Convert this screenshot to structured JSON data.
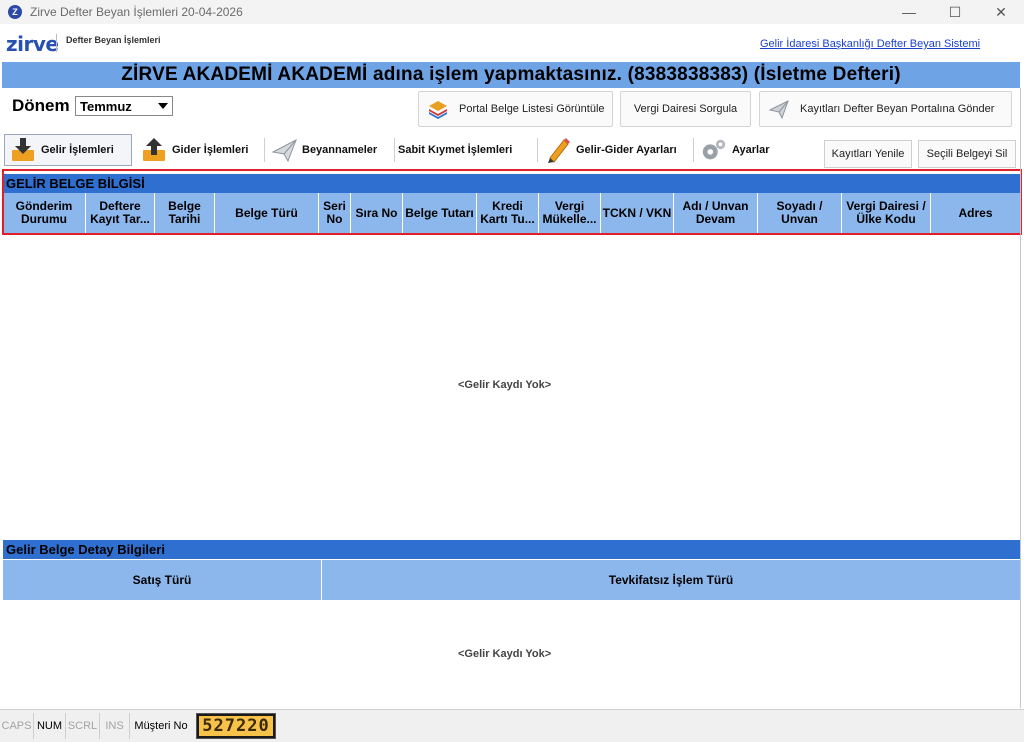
{
  "window": {
    "title": "Zirve Defter Beyan İşlemleri 20-04-2026",
    "icon_letter": "Z",
    "minimize": "—",
    "maximize": "☐",
    "close": "✕"
  },
  "header": {
    "logo": "zirve",
    "module_name": "Defter Beyan İşlemleri",
    "portal_link": "Gelir İdaresi Başkanlığı Defter Beyan Sistemi"
  },
  "banner": {
    "text": "ZİRVE AKADEMİ AKADEMİ adına işlem yapmaktasınız. (8383838383) (İsletme Defteri)"
  },
  "period": {
    "label": "Dönem",
    "selected": "Temmuz"
  },
  "toolbar": {
    "portal_list": "Portal Belge Listesi Görüntüle",
    "tax_office_query": "Vergi Dairesi Sorgula",
    "send_records": "Kayıtları Defter Beyan Portalına Gönder"
  },
  "tabs": [
    {
      "label": "Gelir İşlemleri"
    },
    {
      "label": "Gider İşlemleri"
    },
    {
      "label": "Beyannameler"
    },
    {
      "label": "Sabit Kıymet İşlemleri"
    },
    {
      "label": "Gelir-Gider Ayarları"
    },
    {
      "label": "Ayarlar"
    }
  ],
  "actions": {
    "refresh": "Kayıtları Yenile",
    "delete_selected": "Seçili Belgeyi Sil"
  },
  "income_grid": {
    "section_title": "GELİR BELGE BİLGİSİ",
    "columns": [
      "Gönderim Durumu",
      "Deftere Kayıt Tar...",
      "Belge Tarihi",
      "Belge Türü",
      "Seri No",
      "Sıra No",
      "Belge Tutarı",
      "Kredi Kartı Tu...",
      "Vergi Mükelle...",
      "TCKN / VKN",
      "Adı / Unvan Devam",
      "Soyadı / Unvan",
      "Vergi Dairesi / Ülke Kodu",
      "Adres"
    ],
    "empty_text": "<Gelir Kaydı Yok>"
  },
  "detail_grid": {
    "section_title": "Gelir Belge Detay Bilgileri",
    "columns": [
      "Satış Türü",
      "Tevkifatsız İşlem Türü"
    ],
    "empty_text": "<Gelir Kaydı Yok>"
  },
  "statusbar": {
    "caps": "CAPS",
    "num": "NUM",
    "scrl": "SCRL",
    "ins": "INS",
    "customer_label": "Müşteri No",
    "customer_no": "527220"
  }
}
